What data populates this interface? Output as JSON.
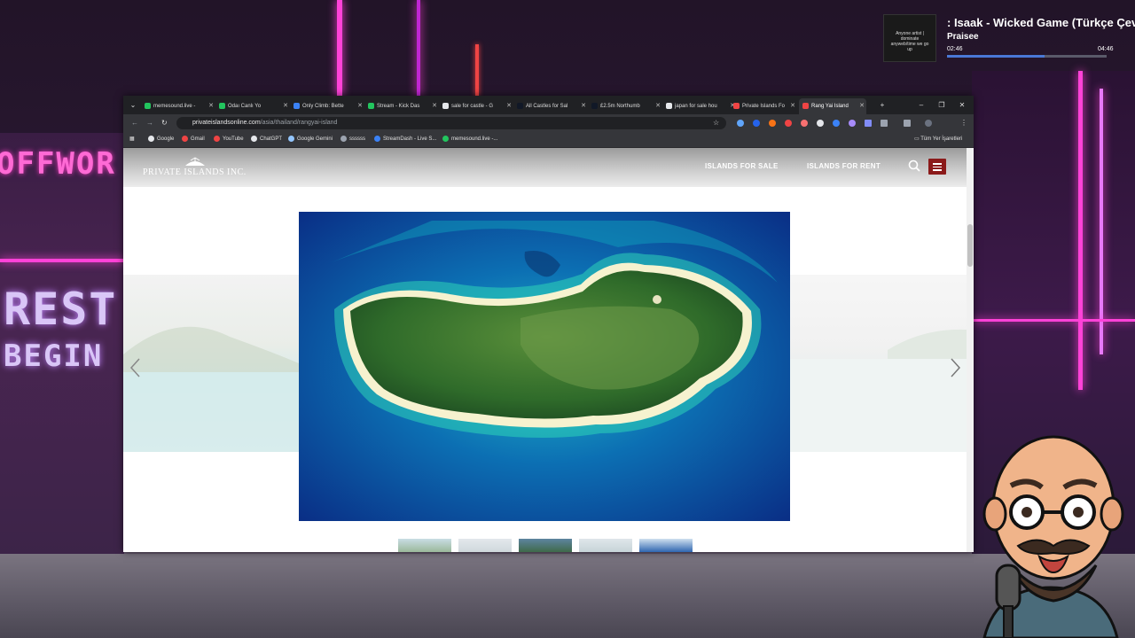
{
  "stream": {
    "neon_sign_1": "OFFWOR",
    "neon_sign_2": "REST",
    "neon_sign_3": "BEGIN"
  },
  "music": {
    "title": ": Isaak - Wicked Game (Türkçe Çev",
    "artist": "Praisee",
    "elapsed": "02:46",
    "duration": "04:46",
    "progress": 0.61,
    "thumb_text": "Anyone artist | dominate anyweb/time we go up"
  },
  "browser": {
    "tabs": [
      {
        "label": "memesound.live -",
        "color": "#22c55e"
      },
      {
        "label": "Odaı Canlı Yo",
        "color": "#22c55e"
      },
      {
        "label": "Only Climb: Bette",
        "color": "#3b82f6"
      },
      {
        "label": "Stream - Kick Das",
        "color": "#22c55e"
      },
      {
        "label": "sale for castle - G",
        "color": "#e5e7eb"
      },
      {
        "label": "All Castles for Sal",
        "color": "#111827"
      },
      {
        "label": "£2.5m Northumb",
        "color": "#111827"
      },
      {
        "label": "japan for sale hou",
        "color": "#e5e7eb"
      },
      {
        "label": "Private Islands Fo",
        "color": "#ef4444"
      },
      {
        "label": "Rang Yai Island",
        "color": "#ef4444"
      }
    ],
    "active_tab": 9,
    "new_tab": "+",
    "url_host": "privateislandsonline.com",
    "url_path": "/asia/thailand/rangyai-island",
    "bookmarks": [
      {
        "label": "Google",
        "color": "#e5e7eb"
      },
      {
        "label": "Gmail",
        "color": "#ef4444"
      },
      {
        "label": "YouTube",
        "color": "#ef4444"
      },
      {
        "label": "ChatGPT",
        "color": "#e5e7eb"
      },
      {
        "label": "Google Gemini",
        "color": "#93c5fd"
      },
      {
        "label": "ssssss",
        "color": "#9ca3af"
      },
      {
        "label": "StreamDash - Live S...",
        "color": "#3b82f6"
      },
      {
        "label": "memesound.live -...",
        "color": "#22c55e"
      }
    ],
    "all_bookmarks": "Tüm Yer İşaretleri"
  },
  "site": {
    "logo": "PRIVATE ISLANDS INC.",
    "nav_sale": "ISLANDS FOR SALE",
    "nav_rent": "ISLANDS FOR RENT"
  }
}
